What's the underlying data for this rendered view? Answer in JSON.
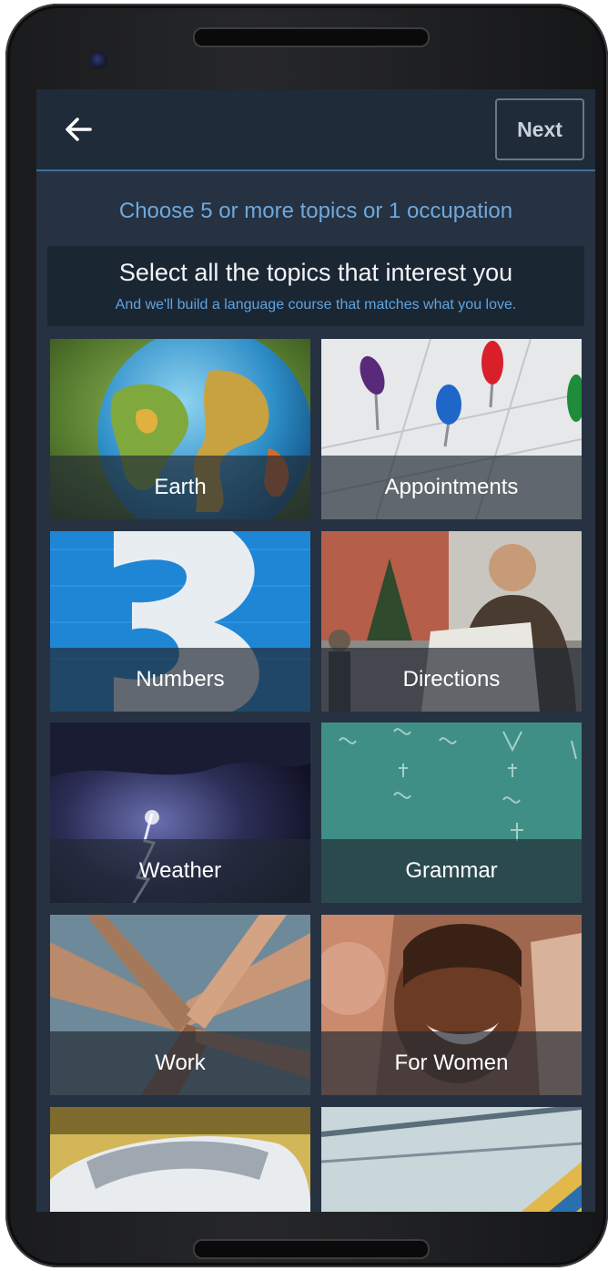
{
  "header": {
    "back_label": "Back",
    "next_label": "Next"
  },
  "instruction": "Choose 5 or more topics or 1 occupation",
  "banner": {
    "title": "Select all the topics that interest you",
    "subtitle": "And we'll build a language course that matches what you love."
  },
  "topics": [
    {
      "label": "Earth"
    },
    {
      "label": "Appointments"
    },
    {
      "label": "Numbers"
    },
    {
      "label": "Directions"
    },
    {
      "label": "Weather"
    },
    {
      "label": "Grammar"
    },
    {
      "label": "Work"
    },
    {
      "label": "For Women"
    },
    {
      "label": ""
    },
    {
      "label": ""
    }
  ],
  "colors": {
    "screen_bg": "#263241",
    "appbar_bg": "#1f2b39",
    "accent_blue": "#6fa8dc",
    "divider": "#3f6f9c"
  },
  "icons": {
    "back": "arrow-left-icon"
  }
}
